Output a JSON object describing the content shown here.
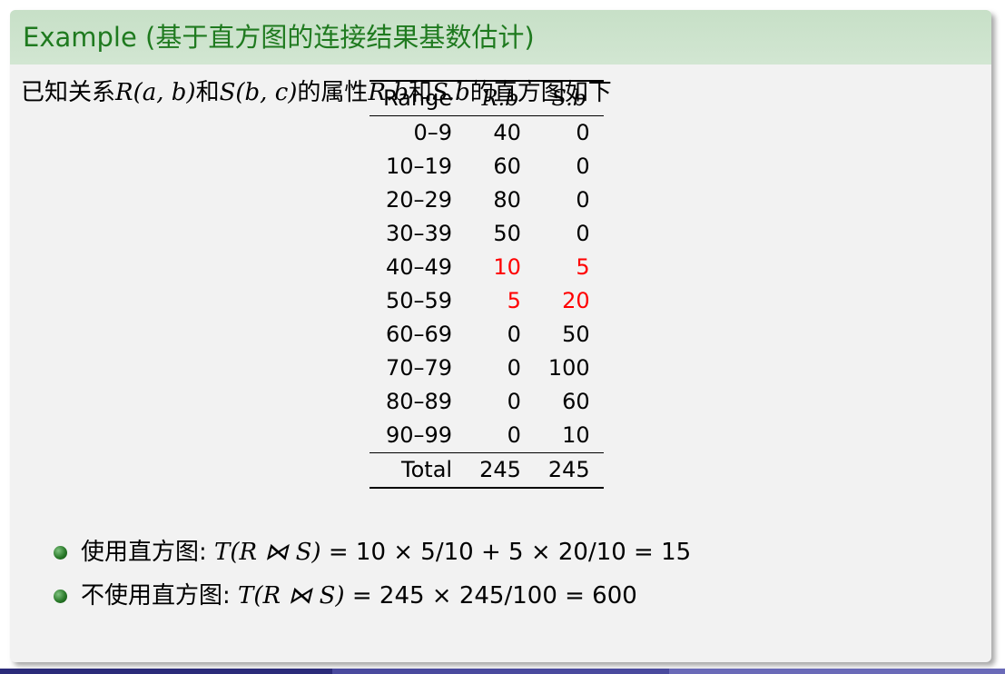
{
  "block": {
    "title_prefix": "Example (",
    "title_cn": "基于直方图的连接结果基数估计",
    "title_suffix": ")"
  },
  "intro": {
    "t1": "已知关系",
    "r": "R",
    "r_args": "(a, b)",
    "and1": "和",
    "s": "S",
    "s_args": "(b, c)",
    "t2": "的属性",
    "rb": "R.b",
    "and2": "和",
    "sb": "S.b",
    "t3": "的直方图如下"
  },
  "table": {
    "headers": [
      "Range",
      "R.b",
      "S.b"
    ],
    "rows": [
      {
        "range": "0–9",
        "rb": "40",
        "sb": "0"
      },
      {
        "range": "10–19",
        "rb": "60",
        "sb": "0"
      },
      {
        "range": "20–29",
        "rb": "80",
        "sb": "0"
      },
      {
        "range": "30–39",
        "rb": "50",
        "sb": "0"
      },
      {
        "range": "40–49",
        "rb": "10",
        "sb": "5"
      },
      {
        "range": "50–59",
        "rb": "5",
        "sb": "20"
      },
      {
        "range": "60–69",
        "rb": "0",
        "sb": "50"
      },
      {
        "range": "70–79",
        "rb": "0",
        "sb": "100"
      },
      {
        "range": "80–89",
        "rb": "0",
        "sb": "60"
      },
      {
        "range": "90–99",
        "rb": "0",
        "sb": "10"
      }
    ],
    "total": {
      "label": "Total",
      "rb": "245",
      "sb": "245"
    },
    "highlight_color": "#ff0000"
  },
  "bullets": [
    {
      "label": "使用直方图:",
      "fn": "T",
      "args": "(R ⋈ S)",
      "rhs": " = 10 × 5/10 + 5 × 20/10 = 15"
    },
    {
      "label": "不使用直方图:",
      "fn": "T",
      "args": "(R ⋈ S)",
      "rhs": " = 245 × 245/100 = 600"
    }
  ],
  "colors": {
    "title_text": "#1f7a1f",
    "title_bg": "#c7e0c7",
    "body_bg": "#f2f2f2",
    "footer_1": "#2b2b7a",
    "footer_2": "#4a4a9e",
    "footer_3": "#6a6ab8"
  }
}
